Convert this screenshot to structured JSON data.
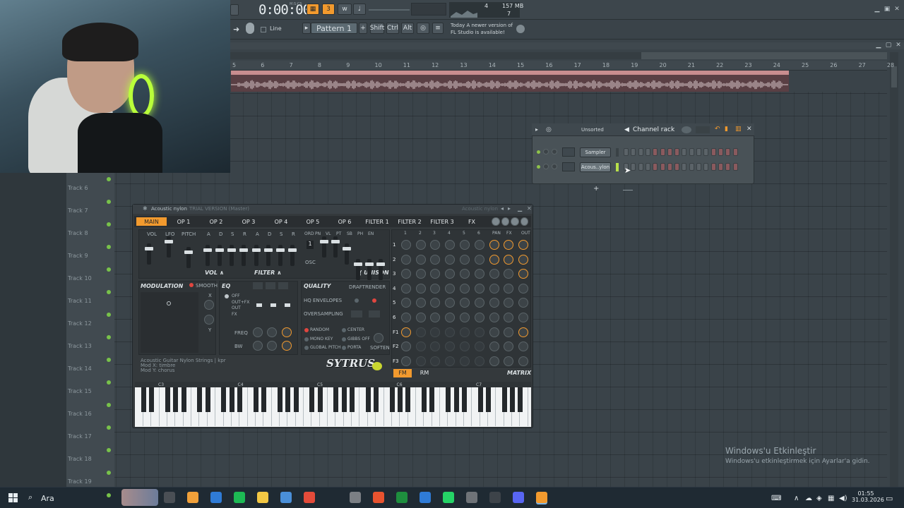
{
  "toolbar": {
    "time": "0:00:00",
    "time_unit": "M:S:CS",
    "pattern_label": "Pattern 1",
    "line_label": "Line",
    "shift": "Shift",
    "ctrl": "Ctrl",
    "alt": "Alt",
    "news_line1": "Today  A newer version of",
    "news_line2": "FL Studio is available!",
    "cpu_value": "4",
    "mem_value": "157 MB",
    "poly_value": "7"
  },
  "ruler": {
    "numbers": [
      "5",
      "6",
      "7",
      "8",
      "9",
      "10",
      "11",
      "12",
      "13",
      "14",
      "15",
      "16",
      "17",
      "18",
      "19",
      "20",
      "21",
      "22",
      "23",
      "24",
      "25",
      "26",
      "27",
      "28"
    ]
  },
  "tracks": [
    "Track 6",
    "Track 7",
    "Track 8",
    "Track 9",
    "Track 10",
    "Track 11",
    "Track 12",
    "Track 13",
    "Track 14",
    "Track 15",
    "Track 16",
    "Track 17",
    "Track 18",
    "Track 19"
  ],
  "channel_rack": {
    "filter": "Unsorted",
    "title": "Channel rack",
    "channels": [
      "Sampler",
      "Acous..ylon"
    ],
    "add_label": "+"
  },
  "sytrus": {
    "title": "Acoustic nylon",
    "title_suffix": "TRIAL VERSION (Master)",
    "title_right": "Acoustic nylon",
    "tabs": [
      "MAIN",
      "OP 1",
      "OP 2",
      "OP 3",
      "OP 4",
      "OP 5",
      "OP 6",
      "FILTER 1",
      "FILTER 2",
      "FILTER 3",
      "FX"
    ],
    "main_labels": [
      "VOL",
      "LFO",
      "PITCH"
    ],
    "env_labels": [
      "A",
      "D",
      "S",
      "R",
      "A",
      "D",
      "S",
      "R"
    ],
    "vol_label": "VOL",
    "filter_label": "FILTER",
    "ord_labels": [
      "ORD",
      "PN",
      "VL",
      "PT",
      "SB",
      "PH",
      "EN"
    ],
    "ord_value": "1",
    "osc_label": "OSC",
    "unison_label": "UNISON",
    "matrix_cols": [
      "1",
      "2",
      "3",
      "4",
      "5",
      "6",
      "PAN",
      "FX",
      "OUT"
    ],
    "matrix_rows": [
      "1",
      "2",
      "3",
      "4",
      "5",
      "6",
      "F1",
      "F2",
      "F3"
    ],
    "modulation": "MODULATION",
    "smooth": "SMOOTH",
    "x_label": "X",
    "y_label": "Y",
    "eq": "EQ",
    "eq_opts": [
      "OFF",
      "OUT+FX",
      "OUT",
      "FX"
    ],
    "freq": "FREQ",
    "bw": "BW",
    "quality": "QUALITY",
    "draft": "DRAFT",
    "render": "RENDER",
    "hq_env": "HQ ENVELOPES",
    "oversampling": "OVERSAMPLING",
    "opts_left": [
      "RANDOM",
      "MONO KEY",
      "GLOBAL PITCH"
    ],
    "opts_right": [
      "CENTER",
      "GIBBS OFF",
      "PORTA"
    ],
    "soften": "SOFTEN",
    "info_line1": "Acoustic Guitar Nylon Strings    | kpr",
    "info_line2": "Mod X: timbre",
    "info_line3": "Mod Y: chorus",
    "logo": "SYTRUS",
    "fm": "FM",
    "rm": "RM",
    "matrix": "MATRIX",
    "octaves": [
      "C3",
      "C4",
      "C5",
      "C6",
      "C7"
    ]
  },
  "watermark": {
    "line1": "Windows'u Etkinleştir",
    "line2": "Windows'u etkinleştirmek için Ayarlar'a gidin."
  },
  "taskbar": {
    "search": "Ara",
    "time": "01:55",
    "date": "31.03.2026"
  }
}
